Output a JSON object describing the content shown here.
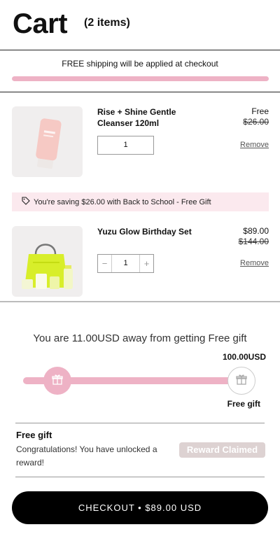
{
  "header": {
    "title": "Cart",
    "item_count": "(2 items)"
  },
  "shipping": {
    "message": "FREE shipping will be applied at checkout",
    "progress": 1.0
  },
  "items": [
    {
      "name": "Rise + Shine Gentle Cleanser 120ml",
      "price": "Free",
      "compare_price": "$26.00",
      "quantity": "1",
      "remove_label": "Remove",
      "image": "cleanser-tube"
    },
    {
      "name": "Yuzu Glow Birthday Set",
      "price": "$89.00",
      "compare_price": "$144.00",
      "quantity": "1",
      "minus": "−",
      "plus": "+",
      "remove_label": "Remove",
      "image": "yuzu-set-bag"
    }
  ],
  "saving_banner": {
    "icon": "tag-icon",
    "text": "You're saving $26.00 with Back to School - Free Gift"
  },
  "gift": {
    "headline": "You are 11.00USD away from getting Free gift",
    "goal_amount": "100.00USD",
    "goal_label": "Free gift",
    "progress": 0.89,
    "icon": "gift-icon"
  },
  "free_gift": {
    "title": "Free gift",
    "description": "Congratulations! You have unlocked a reward!",
    "button_label": "Reward Claimed"
  },
  "checkout": {
    "label": "CHECKOUT • $89.00 USD"
  },
  "colors": {
    "accent_pink": "#eeb2c5",
    "saving_bg": "#fbe9ee",
    "checkout_bg": "#000000"
  }
}
